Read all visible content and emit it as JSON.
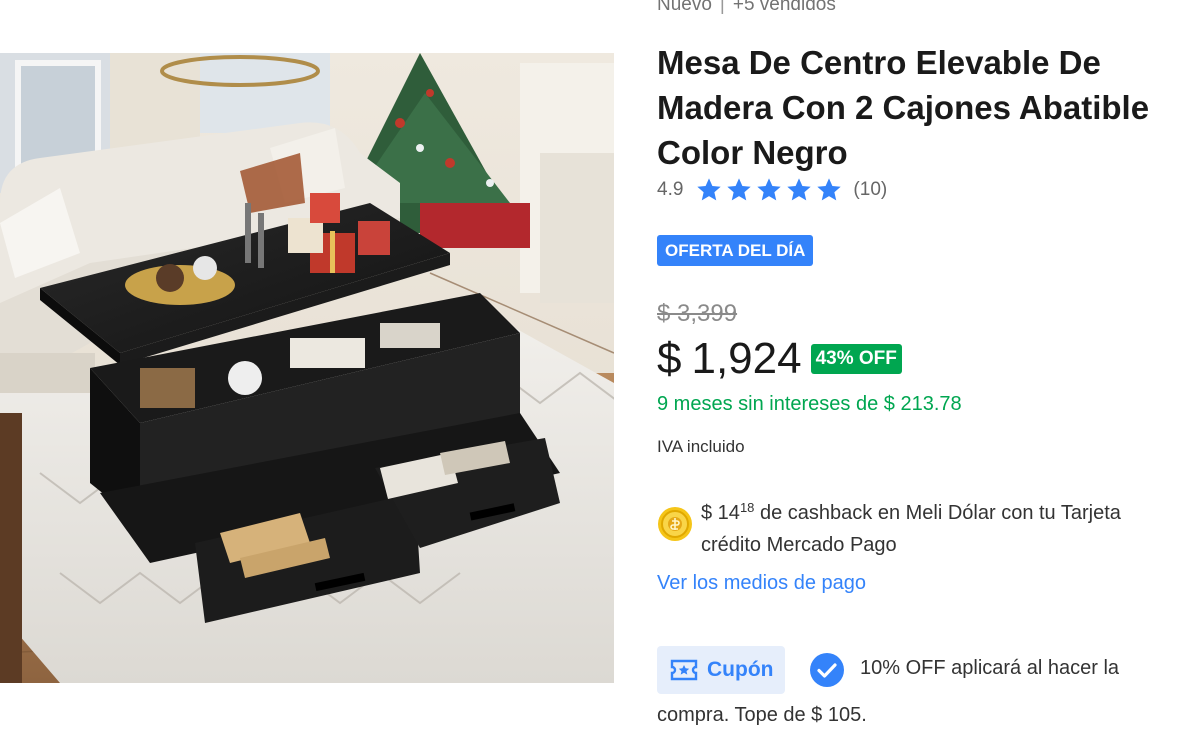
{
  "product": {
    "condition": "Nuevo",
    "separator": "|",
    "sold": "+5 vendidos",
    "title_lines": [
      "Mesa De Centro Elevable De",
      "Madera Con 2 Cajones Abatible",
      "Color Negro"
    ],
    "rating": {
      "value": "4.9",
      "stars": 5,
      "count": "(10)"
    },
    "deal_badge": "OFERTA DEL DÍA",
    "price": {
      "old": "$ 3,399",
      "currency": "$",
      "current": "1,924",
      "discount": "43% OFF"
    },
    "installments": "9 meses sin intereses de $ 213.78",
    "tax_note": "IVA incluido",
    "cashback": {
      "prefix": "$ 14",
      "cents": "18",
      "line1_rest": " de cashback en Meli Dólar con tu Tarjeta",
      "line2": "crédito Mercado Pago"
    },
    "payment_link": "Ver los medios de pago",
    "coupon": {
      "label": "Cupón",
      "text": "10% OFF aplicará al hacer la",
      "text2": "compra. Tope de $ 105."
    }
  },
  "colors": {
    "accent": "#3483fa",
    "success": "#00a650",
    "text": "#333333",
    "muted": "#737373"
  },
  "icons": {
    "star": "star-icon",
    "coin": "meli-dolar-coin-icon",
    "coupon": "coupon-icon",
    "check": "check-circle-icon"
  }
}
